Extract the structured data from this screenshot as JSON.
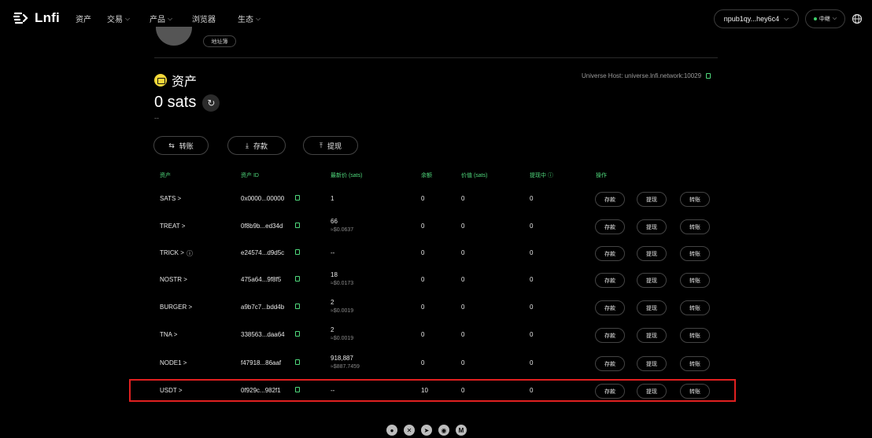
{
  "nav": {
    "brand": "Lnfi",
    "items": [
      {
        "label": "资产",
        "dropdown": false
      },
      {
        "label": "交易",
        "dropdown": true
      },
      {
        "label": "产品",
        "dropdown": true
      },
      {
        "label": "浏览器",
        "dropdown": false
      },
      {
        "label": "生态",
        "dropdown": true
      }
    ],
    "wallet": "npub1qy...hey6c4",
    "network": "中继"
  },
  "profile": {
    "address_button": "地址簿"
  },
  "assets": {
    "title": "资产",
    "universe_host": "Universe Host: universe.lnfi.network:10029",
    "balance": "0 sats",
    "balance_sub": "--",
    "actions": [
      {
        "label": "转账",
        "icon": "transfer-icon"
      },
      {
        "label": "存款",
        "icon": "deposit-icon"
      },
      {
        "label": "提现",
        "icon": "withdraw-icon"
      }
    ]
  },
  "table": {
    "headers": [
      "资产",
      "资产 ID",
      "最新价 (sats)",
      "余额",
      "价值 (sats)",
      "提现中",
      "操作"
    ],
    "row_buttons": [
      "存款",
      "提现",
      "转账"
    ],
    "rows": [
      {
        "asset": "SATS >",
        "id": "0x0000...00000",
        "price": "1",
        "price_usd": "",
        "balance": "0",
        "value": "0",
        "withdrawing": "0"
      },
      {
        "asset": "TREAT >",
        "id": "0f8b9b...ed34d",
        "price": "66",
        "price_usd": "≈$0.0637",
        "balance": "0",
        "value": "0",
        "withdrawing": "0"
      },
      {
        "asset": "TRICK >",
        "id": "e24574...d9d5c",
        "price": "--",
        "price_usd": "",
        "balance": "0",
        "value": "0",
        "withdrawing": "0"
      },
      {
        "asset": "NOSTR >",
        "id": "475a64...9f8f5",
        "price": "18",
        "price_usd": "≈$0.0173",
        "balance": "0",
        "value": "0",
        "withdrawing": "0"
      },
      {
        "asset": "BURGER >",
        "id": "a9b7c7...bdd4b",
        "price": "2",
        "price_usd": "≈$0.0019",
        "balance": "0",
        "value": "0",
        "withdrawing": "0"
      },
      {
        "asset": "TNA >",
        "id": "338563...daa64",
        "price": "2",
        "price_usd": "≈$0.0019",
        "balance": "0",
        "value": "0",
        "withdrawing": "0"
      },
      {
        "asset": "NODE1 >",
        "id": "f47918...86aaf",
        "price": "918,887",
        "price_usd": "≈$887.7459",
        "balance": "0",
        "value": "0",
        "withdrawing": "0"
      },
      {
        "asset": "USDT >",
        "id": "0f929c...982f1",
        "price": "--",
        "price_usd": "",
        "balance": "10",
        "value": "0",
        "withdrawing": "0"
      }
    ]
  },
  "footer": {
    "icons": [
      "github-icon",
      "twitter-icon",
      "telegram-icon",
      "discord-icon",
      "medium-icon"
    ]
  },
  "colors": {
    "accent": "#4fd97c",
    "highlight": "#e02020",
    "coin": "#f4d83a"
  }
}
